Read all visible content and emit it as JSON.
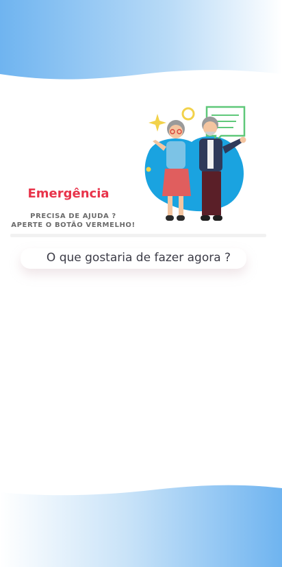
{
  "emergency": {
    "title": "Emergência",
    "subtitle_line1": "PRECISA DE AJUDA ?",
    "subtitle_line2": "APERTE O BOTÃO VERMELHO!"
  },
  "question": {
    "text": "O que gostaria de fazer agora ?"
  },
  "colors": {
    "accent_red": "#e8334a",
    "wave_blue": "#7dbbf2"
  },
  "icons": {
    "illustration": "elderly-couple-illustration"
  }
}
